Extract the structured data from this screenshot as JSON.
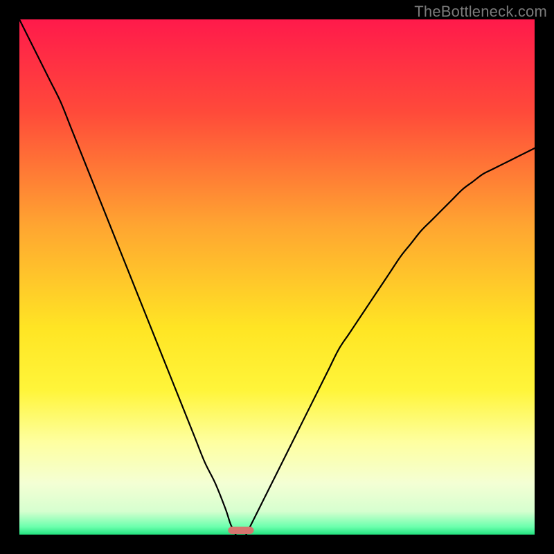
{
  "watermark": "TheBottleneck.com",
  "chart_data": {
    "type": "line",
    "title": "",
    "xlabel": "",
    "ylabel": "",
    "xlim": [
      0,
      100
    ],
    "ylim": [
      0,
      100
    ],
    "grid": false,
    "legend": false,
    "gradient_stops": [
      {
        "offset": 0,
        "color": "#ff1a4b"
      },
      {
        "offset": 0.18,
        "color": "#ff4a3a"
      },
      {
        "offset": 0.4,
        "color": "#ffa531"
      },
      {
        "offset": 0.6,
        "color": "#ffe524"
      },
      {
        "offset": 0.72,
        "color": "#fff53a"
      },
      {
        "offset": 0.82,
        "color": "#feffa0"
      },
      {
        "offset": 0.9,
        "color": "#f4ffd4"
      },
      {
        "offset": 0.955,
        "color": "#d6ffcf"
      },
      {
        "offset": 0.985,
        "color": "#6bffad"
      },
      {
        "offset": 1.0,
        "color": "#22e27f"
      }
    ],
    "curve_color": "#000000",
    "curve_width": 2.2,
    "series": [
      {
        "name": "left-branch",
        "x": [
          0,
          2,
          4,
          6,
          8,
          10,
          12,
          14,
          16,
          18,
          20,
          22,
          24,
          26,
          28,
          30,
          32,
          34,
          36,
          38,
          40,
          41,
          42
        ],
        "y": [
          100,
          96,
          92,
          88,
          84,
          79,
          74,
          69,
          64,
          59,
          54,
          49,
          44,
          39,
          34,
          29,
          24,
          19,
          14,
          10,
          5,
          2,
          0
        ]
      },
      {
        "name": "right-branch",
        "x": [
          44,
          46,
          48,
          50,
          52,
          54,
          56,
          58,
          60,
          62,
          64,
          66,
          68,
          70,
          72,
          74,
          76,
          78,
          80,
          82,
          84,
          86,
          88,
          90,
          92,
          94,
          96,
          98,
          100
        ],
        "y": [
          0,
          4,
          8,
          12,
          16,
          20,
          24,
          28,
          32,
          36,
          39,
          42,
          45,
          48,
          51,
          54,
          56.5,
          59,
          61,
          63,
          65,
          67,
          68.5,
          70,
          71,
          72,
          73,
          74,
          75
        ]
      }
    ],
    "marker": {
      "x_center": 43,
      "width": 5,
      "height": 1.4,
      "color": "#d5766f",
      "radius": 0.7
    }
  }
}
